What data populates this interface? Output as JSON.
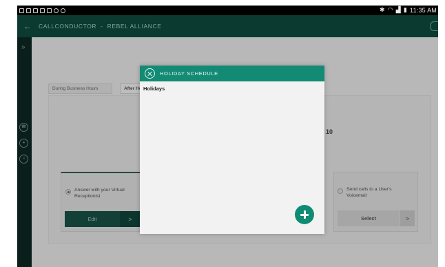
{
  "status_bar": {
    "time": "11:35 AM",
    "left_icons": [
      "notification-icon",
      "notification-icon",
      "usb-icon",
      "image-icon",
      "download-icon",
      "settings-icon",
      "app-icon"
    ],
    "right_icons": [
      "bluetooth-icon",
      "wifi-icon",
      "signal-icon",
      "battery-icon"
    ]
  },
  "app_bar": {
    "back_label": "←",
    "app_name": "CALLCONDUCTOR",
    "separator": "-",
    "org_name": "REBEL ALLIANCE"
  },
  "rail": {
    "expand_label": "»",
    "icons": [
      "phone-icon",
      "person-icon",
      "chat-icon"
    ]
  },
  "tabs": [
    {
      "label": "During Business Hours",
      "active": false
    },
    {
      "label": "After Hours",
      "active": true
    }
  ],
  "background": {
    "partial_number": "10",
    "options": [
      {
        "label": "Answer with your Virtual Receptionist",
        "selected": true,
        "button": "Edit",
        "arrow": ">"
      },
      {
        "label": "Send calls to a User's Voicemail",
        "selected": false,
        "button": "Select",
        "arrow": ">"
      }
    ]
  },
  "modal": {
    "title": "HOLIDAY SCHEDULE",
    "section_label": "Holidays",
    "add_label": "+"
  },
  "colors": {
    "app_bar": "#0a3a30",
    "rail": "#0c2621",
    "modal_header": "#138a74",
    "fab": "#0e8c73"
  }
}
